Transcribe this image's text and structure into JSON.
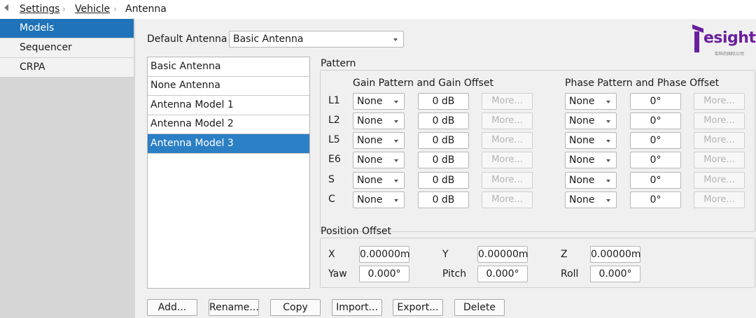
{
  "breadcrumb": [
    "Settings",
    "Vehicle",
    "Antenna"
  ],
  "sidebar": {
    "items": [
      {
        "label": "Models",
        "active": true
      },
      {
        "label": "Sequencer",
        "active": false
      },
      {
        "label": "CRPA",
        "active": false
      }
    ]
  },
  "default_antenna": {
    "label": "Default Antenna",
    "value": "Basic Antenna"
  },
  "antenna_list": [
    {
      "label": "Basic Antenna",
      "selected": false
    },
    {
      "label": "None Antenna",
      "selected": false
    },
    {
      "label": "Antenna Model 1",
      "selected": false
    },
    {
      "label": "Antenna Model 2",
      "selected": false
    },
    {
      "label": "Antenna Model 3",
      "selected": true
    }
  ],
  "pattern": {
    "title": "Pattern",
    "gain_header": "Gain Pattern and Gain Offset",
    "phase_header": "Phase Pattern and Phase Offset",
    "more_label": "More...",
    "rows": [
      {
        "band": "L1",
        "gain_pattern": "None",
        "gain_offset": "0 dB",
        "phase_pattern": "None",
        "phase_offset": "0°"
      },
      {
        "band": "L2",
        "gain_pattern": "None",
        "gain_offset": "0 dB",
        "phase_pattern": "None",
        "phase_offset": "0°"
      },
      {
        "band": "L5",
        "gain_pattern": "None",
        "gain_offset": "0 dB",
        "phase_pattern": "None",
        "phase_offset": "0°"
      },
      {
        "band": "E6",
        "gain_pattern": "None",
        "gain_offset": "0 dB",
        "phase_pattern": "None",
        "phase_offset": "0°"
      },
      {
        "band": "S",
        "gain_pattern": "None",
        "gain_offset": "0 dB",
        "phase_pattern": "None",
        "phase_offset": "0°"
      },
      {
        "band": "C",
        "gain_pattern": "None",
        "gain_offset": "0 dB",
        "phase_pattern": "None",
        "phase_offset": "0°"
      }
    ]
  },
  "position_offset": {
    "title": "Position Offset",
    "x": {
      "label": "X",
      "value": "0.00000m"
    },
    "y": {
      "label": "Y",
      "value": "0.00000m"
    },
    "z": {
      "label": "Z",
      "value": "0.00000m"
    },
    "yaw": {
      "label": "Yaw",
      "value": "0.000°"
    },
    "pitch": {
      "label": "Pitch",
      "value": "0.000°"
    },
    "roll": {
      "label": "Roll",
      "value": "0.000°"
    }
  },
  "actions": {
    "add": "Add...",
    "rename": "Rename...",
    "copy": "Copy",
    "import": "Import...",
    "export": "Export...",
    "delete": "Delete"
  },
  "logo": {
    "text": "esight",
    "sub": "犁科的国际公司"
  },
  "colors": {
    "accent": "#1f73b8",
    "selection": "#2b7fc4",
    "logo": "#6a1f9c"
  }
}
